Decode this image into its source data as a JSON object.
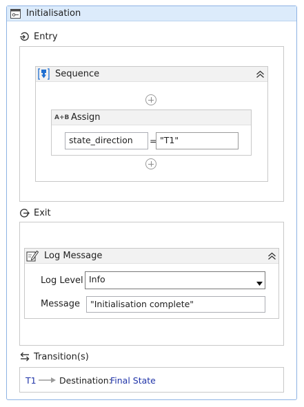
{
  "state": {
    "title": "Initialisation"
  },
  "entry": {
    "label": "Entry",
    "sequence": {
      "title": "Sequence",
      "assign": {
        "title": "Assign",
        "icon_text": "A+B",
        "to_value": "state_direction",
        "operator": "=",
        "value": "\"T1\""
      }
    }
  },
  "exit": {
    "label": "Exit",
    "log_message": {
      "title": "Log Message",
      "log_level_label": "Log Level",
      "log_level_value": "Info",
      "message_label": "Message",
      "message_value": "\"Initialisation complete\""
    }
  },
  "transitions": {
    "label": "Transition(s)",
    "items": [
      {
        "name": "T1",
        "destination_label": "Destination:",
        "destination": "Final State"
      }
    ]
  },
  "colors": {
    "accent_blue": "#1f33a8",
    "header_bg": "#dcebfb",
    "border_blue": "#8db2e3"
  }
}
